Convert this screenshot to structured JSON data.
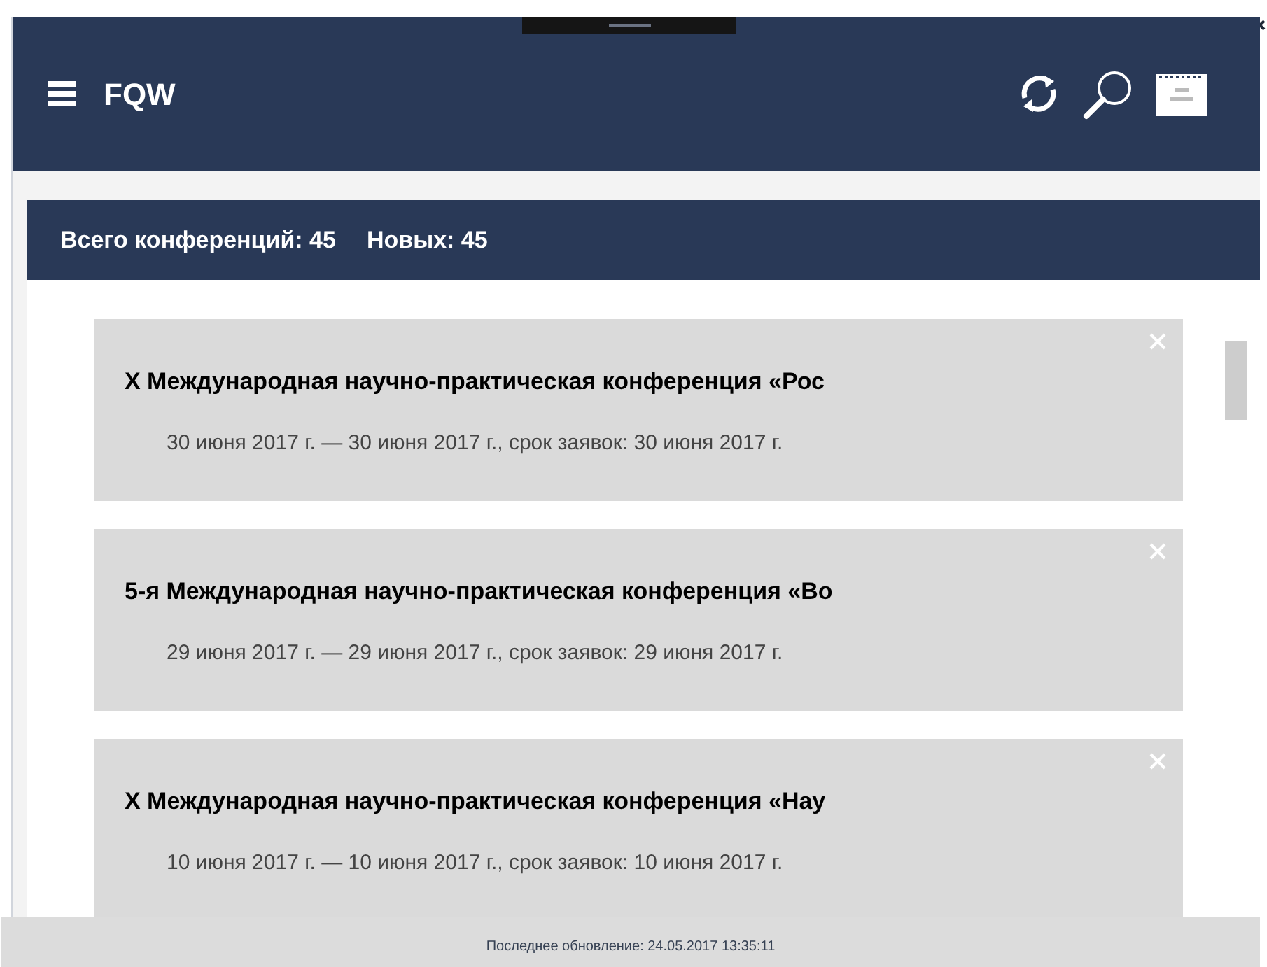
{
  "app_bar": {
    "title": "FQW"
  },
  "summary": {
    "total": "Всего конференций: 45",
    "new": "Новых: 45"
  },
  "conferences": [
    {
      "title": "X Международная научно-практическая конференция «Рос",
      "dates": "30 июня 2017 г. — 30 июня 2017 г., срок заявок: 30 июня 2017 г."
    },
    {
      "title": "5-я Международная научно-практическая конференция «Во",
      "dates": "29 июня 2017 г. — 29 июня 2017 г., срок заявок: 29 июня 2017 г."
    },
    {
      "title": "X Международная научно-практическая конференция «Нау",
      "dates": "10 июня 2017 г. — 10 июня 2017 г., срок заявок: 10 июня 2017 г."
    }
  ],
  "status_bar": {
    "text": "Последнее обновление: 24.05.2017 13:35:11"
  }
}
